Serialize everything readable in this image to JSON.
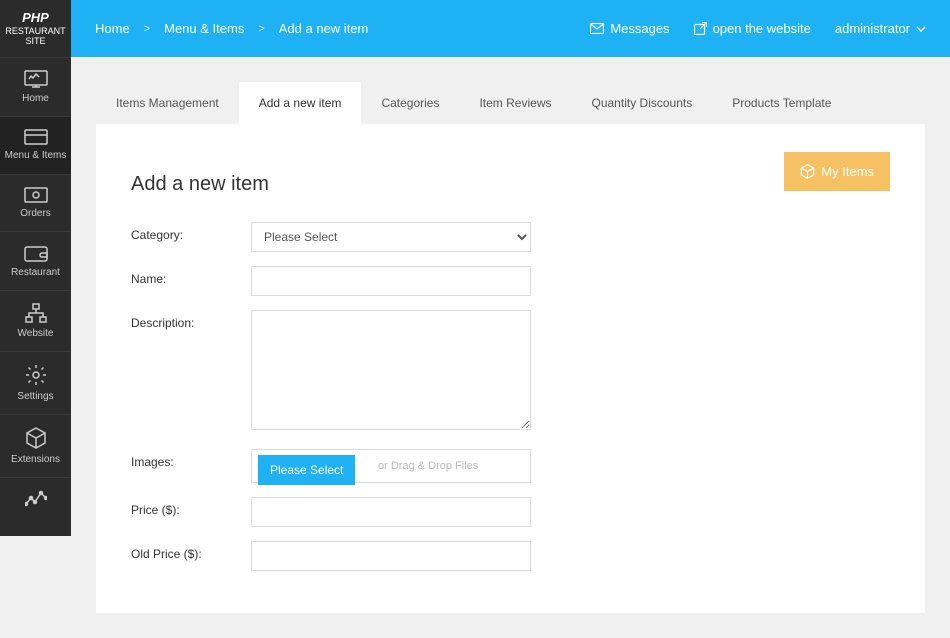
{
  "logo": {
    "brand": "PHP",
    "line1": "RESTAURANT",
    "line2": "SITE"
  },
  "sidebar": {
    "items": [
      {
        "label": "Home"
      },
      {
        "label": "Menu & Items"
      },
      {
        "label": "Orders"
      },
      {
        "label": "Restaurant"
      },
      {
        "label": "Website"
      },
      {
        "label": "Settings"
      },
      {
        "label": "Extensions"
      }
    ]
  },
  "breadcrumb": {
    "home": "Home",
    "section": "Menu & Items",
    "current": "Add a new item",
    "sep": ">"
  },
  "header": {
    "messages": "Messages",
    "open_website": "open the website",
    "user": "administrator"
  },
  "tabs": [
    {
      "label": "Items Management"
    },
    {
      "label": "Add a new item"
    },
    {
      "label": "Categories"
    },
    {
      "label": "Item Reviews"
    },
    {
      "label": "Quantity Discounts"
    },
    {
      "label": "Products Template"
    }
  ],
  "panel": {
    "title": "Add a new item",
    "my_items": "My Items"
  },
  "form": {
    "category_lbl": "Category:",
    "category_ph": "Please Select",
    "name_lbl": "Name:",
    "desc_lbl": "Description:",
    "images_lbl": "Images:",
    "upload_btn": "Please Select",
    "upload_hint": "or Drag & Drop Files",
    "price_lbl": "Price ($):",
    "old_price_lbl": "Old Price ($):"
  }
}
